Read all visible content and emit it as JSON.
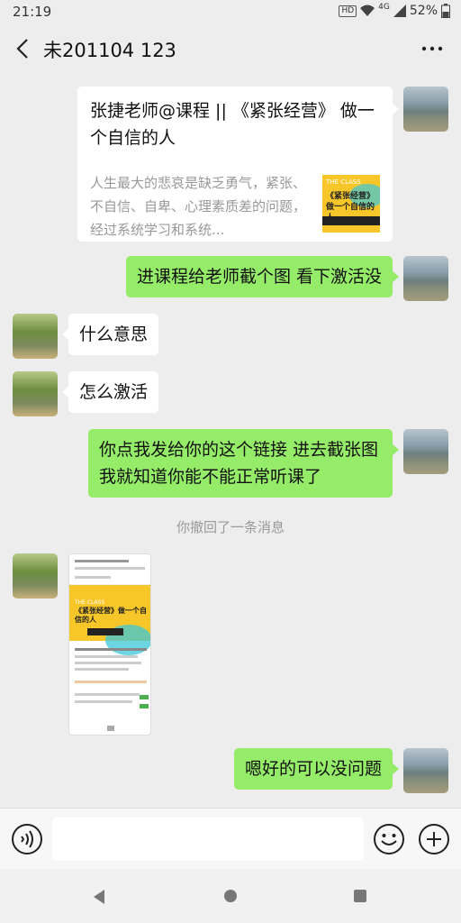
{
  "status_bar": {
    "time": "21:19",
    "hd_badge": "HD",
    "network": "4G",
    "battery": "52%"
  },
  "header": {
    "title": "未201104 123",
    "back_icon": "back-arrow-icon",
    "more_icon": "more-dots-icon"
  },
  "messages": [
    {
      "side": "right",
      "type": "link",
      "title": "张捷老师@课程 || 《紧张经营》 做一个自信的人",
      "description": "人生最大的悲哀是缺乏勇气，紧张、不自信、自卑、心理素质差的问题，经过系统学习和系统...",
      "thumb_small_text": "THE CLASS",
      "thumb_main_text": "《紧张经营》做一个自信的人"
    },
    {
      "side": "right",
      "type": "text",
      "text": "进课程给老师截个图 看下激活没"
    },
    {
      "side": "left",
      "type": "text",
      "text": "什么意思"
    },
    {
      "side": "left",
      "type": "text",
      "text": "怎么激活"
    },
    {
      "side": "right",
      "type": "text",
      "text": "你点我发给你的这个链接 进去截张图 我就知道你能不能正常听课了"
    },
    {
      "side": "center",
      "type": "notice",
      "text": "你撤回了一条消息"
    },
    {
      "side": "left",
      "type": "image",
      "banner_small": "THE CLASS",
      "banner_main": "《紧张经营》做一个自信的人"
    },
    {
      "side": "right",
      "type": "text",
      "text": "嗯好的可以没问题"
    }
  ],
  "input_bar": {
    "voice_icon": "voice-icon",
    "emoji_icon": "emoji-icon",
    "plus_icon": "plus-icon",
    "placeholder": ""
  },
  "colors": {
    "background": "#ededed",
    "bubble_green": "#95ec69",
    "bubble_white": "#ffffff",
    "notice_text": "#999999"
  }
}
